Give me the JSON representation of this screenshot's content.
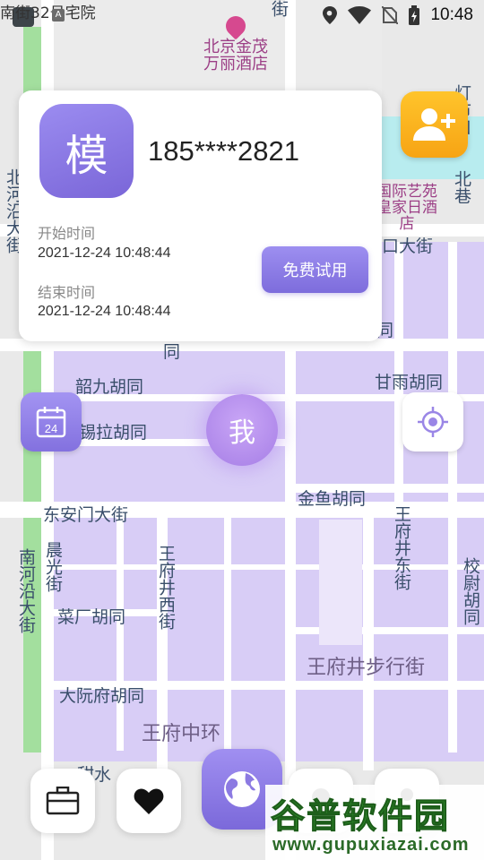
{
  "status_bar": {
    "top_left_text": "南街32号宅院",
    "time": "10:48",
    "icons": [
      "app-a-icon",
      "location-icon",
      "wifi-icon",
      "no-sim-icon",
      "battery-icon"
    ]
  },
  "map": {
    "labels": {
      "poi_hotel_1": "北京金茂万丽酒店",
      "poi_hotel_2": "国际艺苑皇家日酒店",
      "street_north": "街",
      "dengshikou": "灯市口",
      "beixiang": "北巷",
      "beiheyan": "北河沿大街",
      "kou_da_jie": "口大街",
      "tong_1": "同",
      "tong_2": "同",
      "ganyu": "甘雨胡同",
      "shaojiu": "韶九胡同",
      "xila": "锡拉胡同",
      "jinyu": "金鱼胡同",
      "dong_anmen": "东安门大街",
      "nanheyan": "南河沿大街",
      "chenguang": "晨光街",
      "wangfujing_xi": "王府井西街",
      "wangfujing_dong": "王府井东街",
      "xiaowei": "校尉胡同",
      "caichang": "菜厂胡同",
      "wangfujing_walk": "王府井步行街",
      "dayuanfu": "大阮府胡同",
      "wangfu_center": "王府中环",
      "ganshui": "甜水"
    }
  },
  "user_card": {
    "avatar_char": "模",
    "phone": "185****2821",
    "start_label": "开始时间",
    "start_value": "2021-12-24 10:48:44",
    "end_label": "结束时间",
    "end_value": "2021-12-24 10:48:44",
    "trial_button": "免费试用"
  },
  "calendar_button": {
    "day": "24"
  },
  "me_marker": {
    "label": "我"
  },
  "bottom_nav": {
    "items": [
      "briefcase-icon",
      "heart-icon",
      "globe-icon",
      "pin-icon",
      "person-icon"
    ]
  },
  "watermark": {
    "main": "谷普软件园",
    "sub": "www.gupuxiazai.com"
  },
  "colors": {
    "map_district": "#d6ccf5",
    "map_road": "#ffffff",
    "map_base": "#e9e9e9",
    "green_strip": "#9fdf9a",
    "water": "#b8ecef",
    "accent_purple": "#8a78e2",
    "add_button": "#f8ad1b"
  }
}
